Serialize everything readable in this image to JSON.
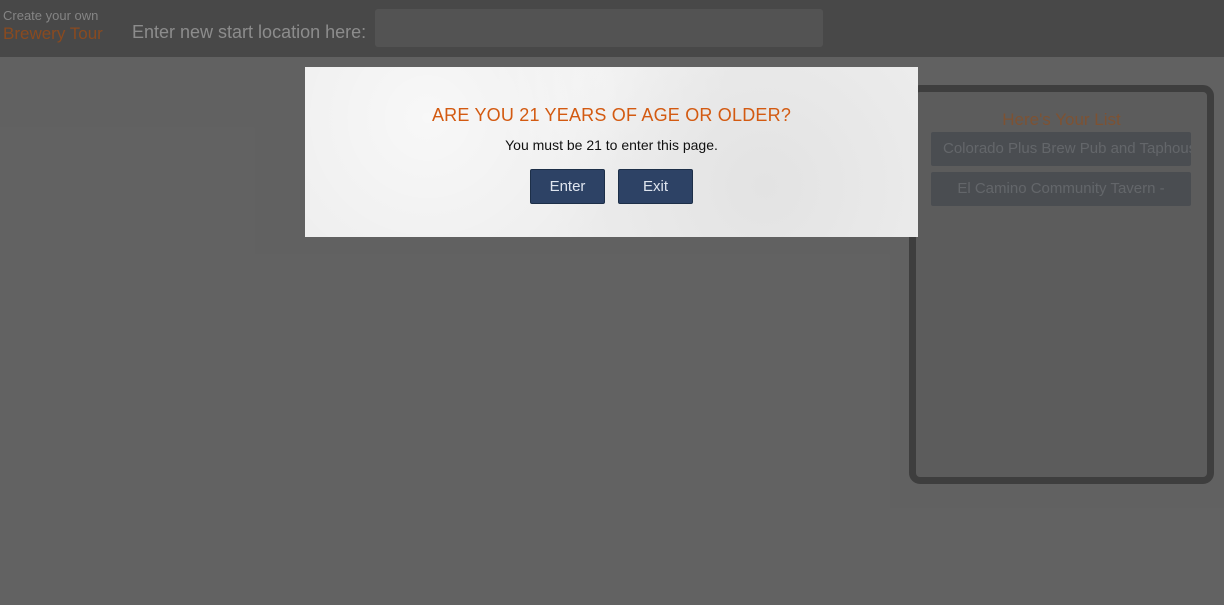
{
  "header": {
    "brand_line1": "Create your own",
    "brand_line2": "Brewery Tour",
    "start_label": "Enter new start location here:",
    "start_input_value": "",
    "start_input_placeholder": ""
  },
  "list_panel": {
    "title": "Here's Your List",
    "items": [
      {
        "label": "Colorado Plus Brew Pub and Taphouse"
      },
      {
        "label": "El Camino Community Tavern -"
      }
    ]
  },
  "modal": {
    "title": "ARE YOU 21 YEARS OF AGE OR OLDER?",
    "message": "You must be 21 to enter this page.",
    "enter_label": "Enter",
    "exit_label": "Exit"
  },
  "colors": {
    "accent_orange": "#d35a11",
    "button_navy": "#2d4265"
  }
}
